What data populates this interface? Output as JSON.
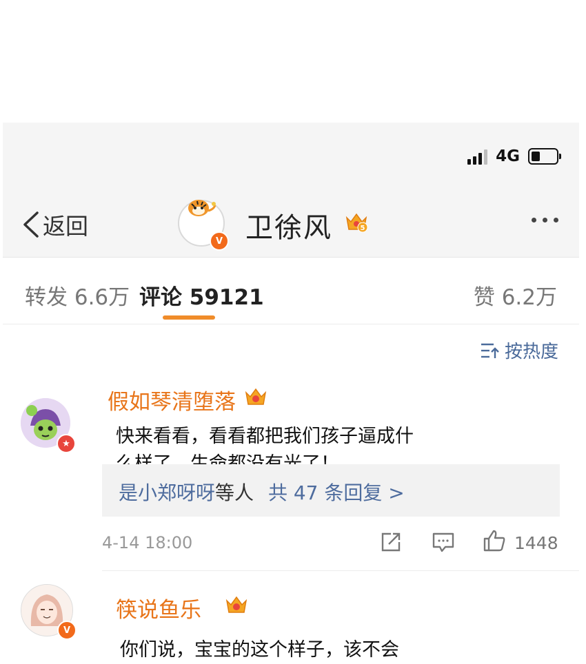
{
  "status": {
    "network": "4G",
    "battery_level": 0.35
  },
  "nav": {
    "back_label": "返回",
    "title": "卫徐风",
    "verified": "V",
    "crown_level": "5"
  },
  "tabs": [
    {
      "label": "转发 6.6万"
    },
    {
      "label": "评论 59121"
    },
    {
      "label": "赞 6.2万"
    }
  ],
  "active_tab": 1,
  "sort_label": "按热度",
  "comments": [
    {
      "name": "假如琴清堕落",
      "text_line1": "快来看看，看看都把我们孩子逼成什",
      "text_line2": "么样了，生命都没有光了！",
      "reply_prefix": "是小郑呀呀",
      "reply_middle": "等人",
      "reply_count": "共 47 条回复 >",
      "time": "4-14 18:00",
      "likes": "1448"
    },
    {
      "name": "筷说鱼乐",
      "text_line1": "你们说，宝宝的这个样子，该不会"
    }
  ],
  "colors": {
    "accent": "#f08c2a",
    "name": "#e8751a",
    "link": "#4e6c9e"
  }
}
